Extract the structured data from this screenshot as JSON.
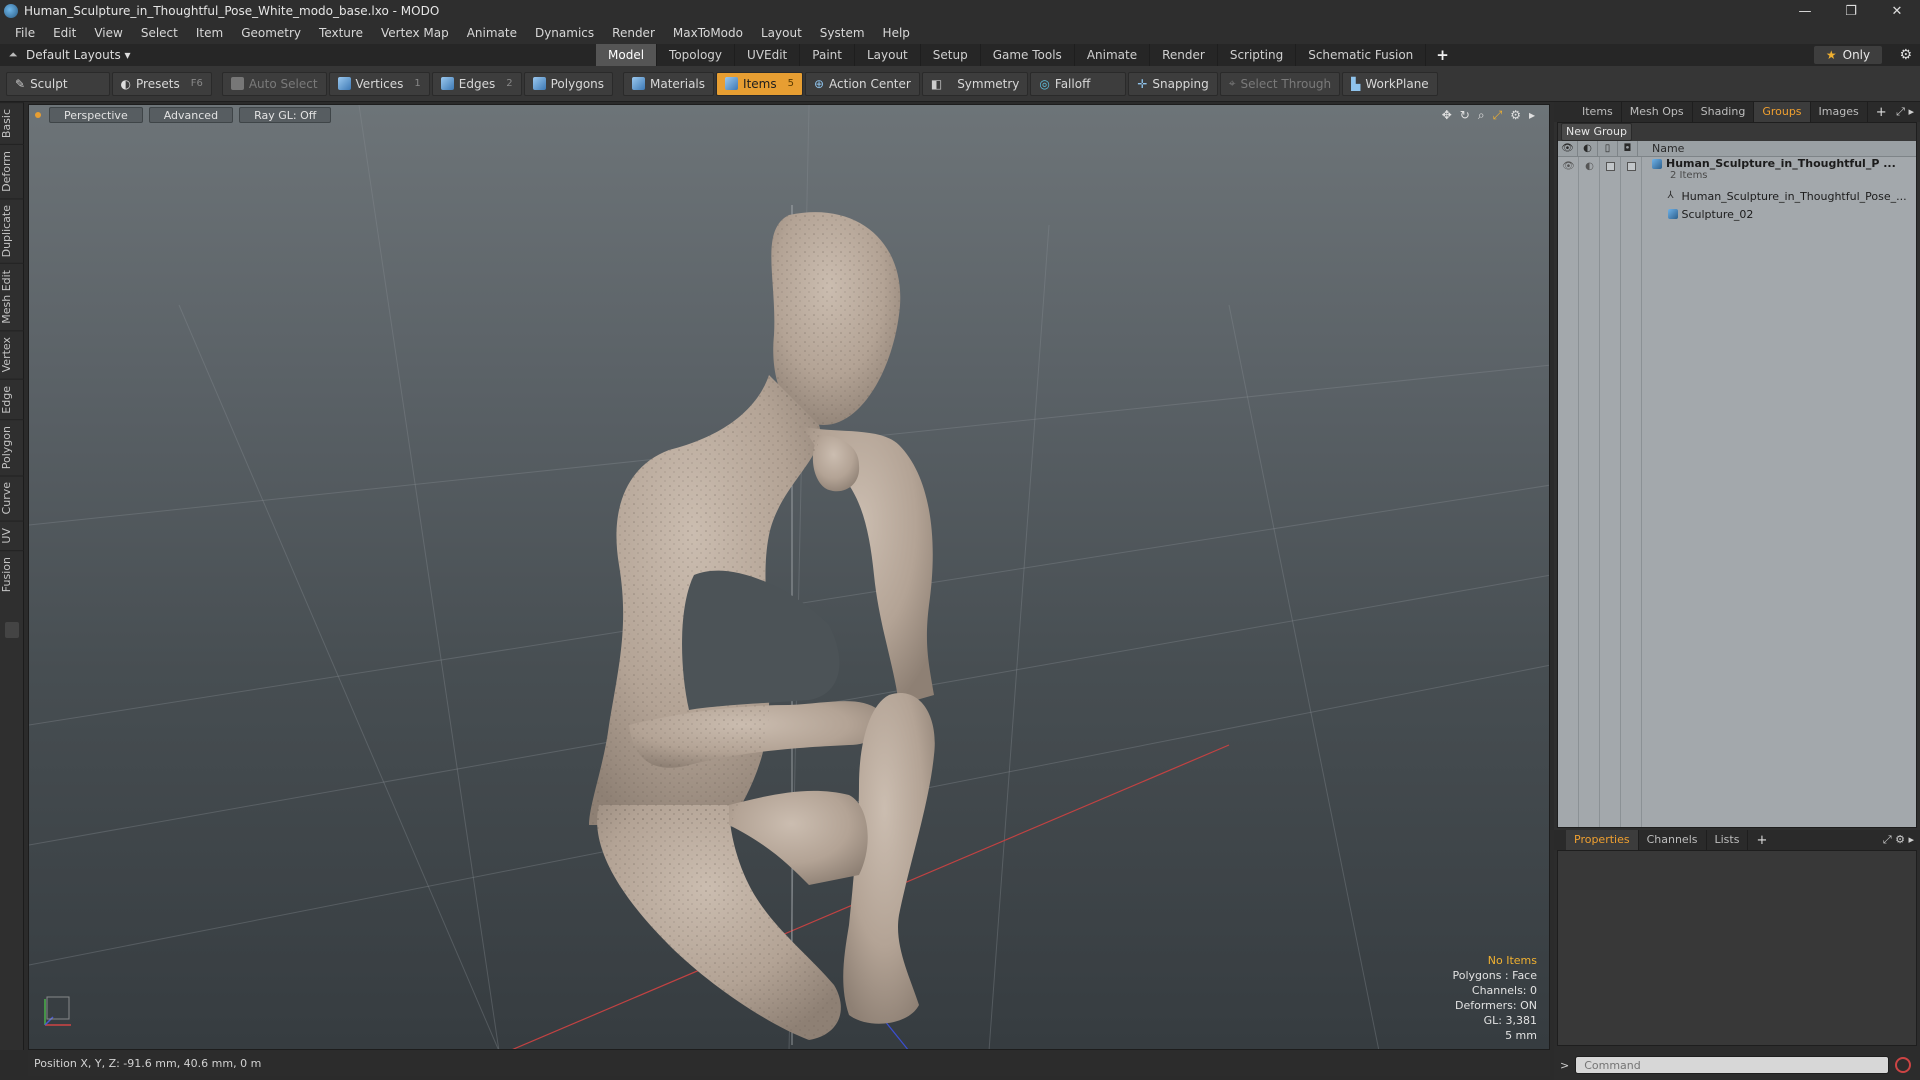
{
  "window": {
    "title": "Human_Sculpture_in_Thoughtful_Pose_White_modo_base.lxo - MODO",
    "minimize": "—",
    "maximize": "❐",
    "close": "✕"
  },
  "menu": [
    "File",
    "Edit",
    "View",
    "Select",
    "Item",
    "Geometry",
    "Texture",
    "Vertex Map",
    "Animate",
    "Dynamics",
    "Render",
    "MaxToModo",
    "Layout",
    "System",
    "Help"
  ],
  "layoutbar": {
    "layout_label": "Default Layouts ▾",
    "tabs": [
      "Model",
      "Topology",
      "UVEdit",
      "Paint",
      "Layout",
      "Setup",
      "Game Tools",
      "Animate",
      "Render",
      "Scripting",
      "Schematic Fusion"
    ],
    "active_tab": "Model",
    "only_label": "Only"
  },
  "toolbar": {
    "sculpt": "Sculpt",
    "presets": "Presets",
    "presets_key": "F6",
    "auto_select": "Auto Select",
    "vertices": "Vertices",
    "vertices_key": "1",
    "edges": "Edges",
    "edges_key": "2",
    "polygons": "Polygons",
    "materials": "Materials",
    "items": "Items",
    "items_key": "5",
    "action_center": "Action Center",
    "symmetry": "Symmetry",
    "falloff": "Falloff",
    "snapping": "Snapping",
    "select_through": "Select Through",
    "workplane": "WorkPlane"
  },
  "leftstrip": [
    "Basic",
    "Deform",
    "Duplicate",
    "Mesh Edit",
    "Vertex",
    "Edge",
    "Polygon",
    "Curve",
    "UV",
    "Fusion"
  ],
  "viewport": {
    "perspective": "Perspective",
    "advanced": "Advanced",
    "raygl": "Ray GL: Off",
    "info": {
      "no_items": "No Items",
      "polygons": "Polygons : Face",
      "channels": "Channels: 0",
      "deformers": "Deformers: ON",
      "gl": "GL: 3,381",
      "scale": "5 mm"
    }
  },
  "statusbar": {
    "position": "Position X, Y, Z:  -91.6 mm, 40.6 mm, 0 m"
  },
  "rightpanel": {
    "tabs": [
      "Items",
      "Mesh Ops",
      "Shading",
      "Groups",
      "Images"
    ],
    "active_tab": "Groups",
    "new_group": "New Group",
    "col_name": "Name",
    "group": {
      "name": "Human_Sculpture_in_Thoughtful_P ...",
      "count": "2 Items",
      "children": [
        "Human_Sculpture_in_Thoughtful_Pose_...",
        "Sculpture_02"
      ]
    },
    "bottom_tabs": [
      "Properties",
      "Channels",
      "Lists"
    ],
    "bottom_active": "Properties",
    "command_prompt": ">",
    "command_placeholder": "Command"
  },
  "colors": {
    "accent": "#e79e32",
    "viewport_top": "#6d7478",
    "sculpture": "#b8a89a"
  }
}
